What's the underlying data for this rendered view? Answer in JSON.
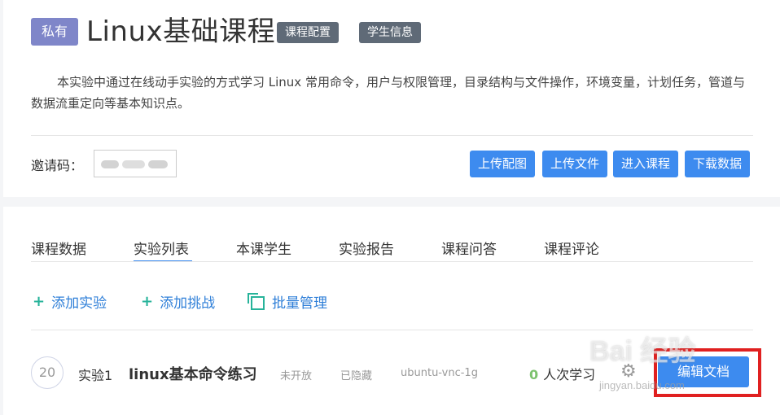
{
  "header": {
    "private_badge": "私有",
    "title": "Linux基础课程",
    "course_config_label": "课程配置",
    "student_info_label": "学生信息",
    "description": "本实验中通过在线动手实验的方式学习 Linux 常用命令，用户与权限管理，目录结构与文件操作，环境变量，计划任务，管道与数据流重定向等基本知识点。"
  },
  "invite": {
    "label": "邀请码："
  },
  "actions": {
    "upload_image": "上传配图",
    "upload_file": "上传文件",
    "enter_course": "进入课程",
    "download_data": "下载数据"
  },
  "tabs": [
    "课程数据",
    "实验列表",
    "本课学生",
    "实验报告",
    "课程问答",
    "课程评论"
  ],
  "active_tab": "实验列表",
  "toolbar": {
    "add_experiment": "添加实验",
    "add_challenge": "添加挑战",
    "batch_manage": "批量管理",
    "plus_icon": "+"
  },
  "experiment": {
    "number": "20",
    "label": "实验1",
    "name": "linux基本命令练习",
    "status_open": "未开放",
    "status_hidden": "已隐藏",
    "environment": "ubuntu-vnc-1g",
    "learner_count": "0",
    "learner_suffix": "人次学习",
    "edit_button": "编辑文档"
  },
  "watermark": {
    "brand": "Bai 经验",
    "url": "jingyan.baidu.com"
  },
  "colors": {
    "primary": "#3d8bef",
    "private_badge": "#7f86c9",
    "tag": "#5f6a77",
    "accent_green": "#27b39a",
    "highlight_red": "#e02020"
  }
}
